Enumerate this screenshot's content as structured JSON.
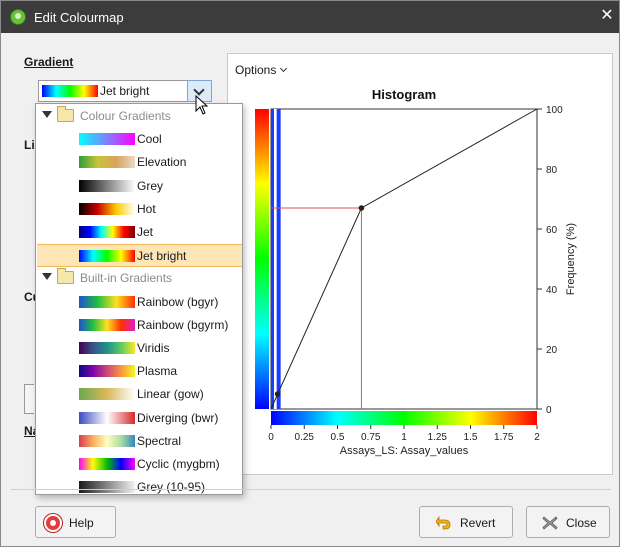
{
  "window": {
    "title": "Edit Colourmap",
    "close_glyph": "✕"
  },
  "gradient": {
    "label": "Gradient",
    "selected": "Jet bright",
    "selected_stops": [
      "#0000ff",
      "#00ffff",
      "#00ff00",
      "#ffff00",
      "#ff0000"
    ]
  },
  "side_labels": {
    "limits": "Lin",
    "custom": "Cu",
    "name": "Na"
  },
  "dropdown": {
    "groups": [
      {
        "label": "Colour Gradients",
        "items": [
          {
            "label": "Cool",
            "stops": [
              "#00ffff",
              "#ff00ff"
            ]
          },
          {
            "label": "Elevation",
            "stops": [
              "#2c9f3a",
              "#c8c43a",
              "#d9a35a",
              "#e8dcc8"
            ]
          },
          {
            "label": "Grey",
            "stops": [
              "#000000",
              "#ffffff"
            ]
          },
          {
            "label": "Hot",
            "stops": [
              "#000000",
              "#cc0000",
              "#ffcc00",
              "#ffffff"
            ]
          },
          {
            "label": "Jet",
            "stops": [
              "#00007f",
              "#0000ff",
              "#00ffff",
              "#ffff00",
              "#ff0000",
              "#7f0000"
            ]
          },
          {
            "label": "Jet bright",
            "stops": [
              "#0000ff",
              "#00ffff",
              "#00ff00",
              "#ffff00",
              "#ff0000"
            ],
            "selected": true
          }
        ]
      },
      {
        "label": "Built-in Gradients",
        "items": [
          {
            "label": "Rainbow (bgyr)",
            "stops": [
              "#2050d0",
              "#20c040",
              "#ffe020",
              "#ff3000"
            ]
          },
          {
            "label": "Rainbow (bgyrm)",
            "stops": [
              "#2050d0",
              "#20c040",
              "#ffe020",
              "#ff3000",
              "#e020c0"
            ]
          },
          {
            "label": "Viridis",
            "stops": [
              "#440154",
              "#3b528b",
              "#21918c",
              "#5ec962",
              "#fde725"
            ]
          },
          {
            "label": "Plasma",
            "stops": [
              "#0d0887",
              "#7e03a8",
              "#cc4778",
              "#f89540",
              "#f0f921"
            ]
          },
          {
            "label": "Linear (gow)",
            "stops": [
              "#6aa84f",
              "#d9b85a",
              "#ffffff"
            ]
          },
          {
            "label": "Diverging (bwr)",
            "stops": [
              "#3b4cc0",
              "#ffffff",
              "#d62828"
            ]
          },
          {
            "label": "Spectral",
            "stops": [
              "#d53e4f",
              "#fdae61",
              "#ffffbf",
              "#abdda4",
              "#3288bd"
            ]
          },
          {
            "label": "Cyclic (mygbm)",
            "stops": [
              "#ff00ff",
              "#ffff00",
              "#00c000",
              "#0000ff",
              "#ff00ff"
            ]
          },
          {
            "label": "Grey (10-95)",
            "stops": [
              "#1a1a1a",
              "#f2f2f2"
            ]
          }
        ]
      }
    ]
  },
  "options": {
    "label": "Options"
  },
  "chart_data": {
    "type": "line",
    "title": "Histogram",
    "xlabel": "Assays_LS: Assay_values",
    "ylabel": "Frequency (%)",
    "x_ticks": [
      "0",
      "0.25",
      "0.5",
      "0.75",
      "1",
      "1.25",
      "1.5",
      "1.75",
      "2"
    ],
    "y_ticks": [
      "0",
      "20",
      "40",
      "60",
      "80",
      "100"
    ],
    "xlim": [
      0,
      2
    ],
    "ylim": [
      0,
      100
    ],
    "points": [
      {
        "x": 0.0,
        "y": 0
      },
      {
        "x": 0.05,
        "y": 5
      },
      {
        "x": 0.68,
        "y": 67
      },
      {
        "x": 2.0,
        "y": 100
      }
    ],
    "marker": {
      "x": 0.68,
      "y": 67
    },
    "highlight_bar_x": 0.05,
    "gradient_stops": [
      "#ff0000",
      "#ffff00",
      "#00ff00",
      "#00ffff",
      "#0000ff"
    ]
  },
  "buttons": {
    "help": "Help",
    "revert": "Revert",
    "close": "Close"
  }
}
